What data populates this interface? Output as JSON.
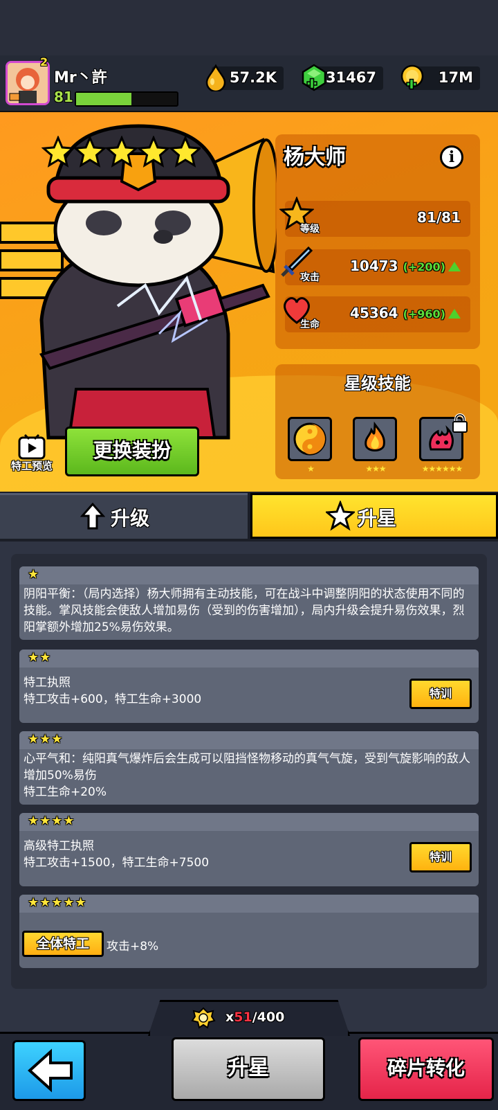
{
  "player": {
    "name": "Mr丶許",
    "level": "81",
    "xp_fraction": 0.55,
    "avatar_badge": "2"
  },
  "currencies": [
    {
      "name": "energy",
      "icon": "drop-icon",
      "value": "57.2K"
    },
    {
      "name": "gems",
      "icon": "gem-plus-icon",
      "value": "31467"
    },
    {
      "name": "coins",
      "icon": "coin-plus-icon",
      "value": "17M"
    }
  ],
  "hero": {
    "name": "杨大师",
    "star_count": 5,
    "stars": "★★★★★",
    "stats": {
      "level_label": "等级",
      "level_value": "81/81",
      "attack_label": "攻击",
      "attack_value": "10473",
      "attack_bonus": "(+200)",
      "hp_label": "生命",
      "hp_value": "45364",
      "hp_bonus": "(+960)"
    },
    "skills_title": "星级技能",
    "skills": [
      {
        "icon": "yin-yang-icon",
        "stars": "★"
      },
      {
        "icon": "fire-palm-icon",
        "stars": "★★★"
      },
      {
        "icon": "fire-demon-icon",
        "stars": "★★★★★★",
        "locked": true
      }
    ]
  },
  "buttons": {
    "preview": "特工预览",
    "change_outfit": "更换装扮",
    "train": "特训",
    "upstar": "升星",
    "shard_convert": "碎片转化"
  },
  "tabs": {
    "upgrade": "升级",
    "star": "升星"
  },
  "star_cards": [
    {
      "stars": "★",
      "text": "阴阳平衡：（局内选择）杨大师拥有主动技能，可在战斗中调整阴阳的状态使用不同的技能。掌风技能会使敌人增加易伤（受到的伤害增加），局内升级会提升易伤效果，烈阳掌额外增加25%易伤效果。"
    },
    {
      "stars": "★★",
      "line1": "特工执照",
      "line2": "特工攻击+600，特工生命+3000"
    },
    {
      "stars": "★★★",
      "text": "心平气和：纯阳真气爆炸后会生成可以阻挡怪物移动的真气气旋，受到气旋影响的敌人增加50%易伤",
      "line2": "特工生命+20%"
    },
    {
      "stars": "★★★★",
      "line1": "高级特工执照",
      "line2": "特工攻击+1500，特工生命+7500"
    },
    {
      "stars": "★★★★★",
      "badge": "全体特工",
      "line2": "攻击+8%"
    }
  ],
  "shards": {
    "prefix": "x",
    "current": "51",
    "total": "/400"
  },
  "colors": {
    "accent": "#ffc61a",
    "hero_bg": "#ff9a1f",
    "bonus_green": "#5dde3a",
    "shard_red": "#ff3344"
  }
}
